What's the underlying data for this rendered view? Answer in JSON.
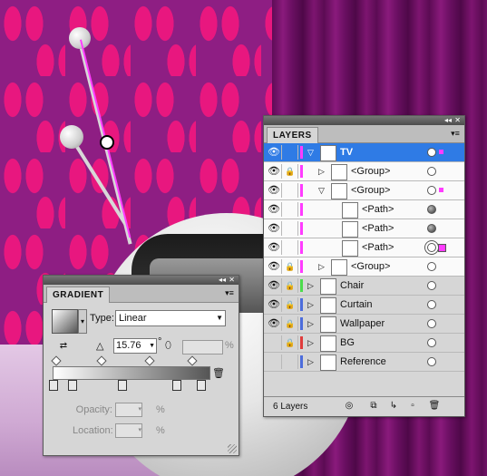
{
  "layers_panel": {
    "tab_label": "LAYERS",
    "footer": {
      "count_label": "6 Layers"
    },
    "rows": [
      {
        "name": "TV",
        "level": 0,
        "expanded": true,
        "selected": true,
        "color": "#ff3cff",
        "eye": true,
        "lock": false,
        "target": "open",
        "marker": "small"
      },
      {
        "name": "<Group>",
        "level": 1,
        "expanded": false,
        "selected": false,
        "color": "#ff3cff",
        "eye": true,
        "lock": true,
        "target": "open",
        "marker": "none"
      },
      {
        "name": "<Group>",
        "level": 1,
        "expanded": true,
        "selected": false,
        "color": "#ff3cff",
        "eye": true,
        "lock": false,
        "target": "open",
        "marker": "small"
      },
      {
        "name": "<Path>",
        "level": 2,
        "selected": false,
        "color": "#ff3cff",
        "eye": true,
        "lock": false,
        "target": "filled",
        "marker": "none"
      },
      {
        "name": "<Path>",
        "level": 2,
        "selected": false,
        "color": "#ff3cff",
        "eye": true,
        "lock": false,
        "target": "filled",
        "marker": "none"
      },
      {
        "name": "<Path>",
        "level": 2,
        "selected": false,
        "color": "#ff3cff",
        "eye": true,
        "lock": false,
        "target": "double",
        "marker": "big"
      },
      {
        "name": "<Group>",
        "level": 1,
        "expanded": false,
        "selected": false,
        "color": "#ff3cff",
        "eye": true,
        "lock": true,
        "target": "open",
        "marker": "none"
      },
      {
        "name": "Chair",
        "level": 0,
        "expanded": false,
        "selected": false,
        "color": "#4ddc4d",
        "eye": true,
        "lock": true,
        "target": "open",
        "marker": "none"
      },
      {
        "name": "Curtain",
        "level": 0,
        "expanded": false,
        "selected": false,
        "color": "#4d6ddc",
        "eye": true,
        "lock": true,
        "target": "open",
        "marker": "none"
      },
      {
        "name": "Wallpaper",
        "level": 0,
        "expanded": false,
        "selected": false,
        "color": "#4d6ddc",
        "eye": true,
        "lock": true,
        "target": "open",
        "marker": "none"
      },
      {
        "name": "BG",
        "level": 0,
        "expanded": false,
        "selected": false,
        "color": "#e03c3c",
        "eye": false,
        "lock": true,
        "target": "open",
        "marker": "none"
      },
      {
        "name": "Reference",
        "level": 0,
        "expanded": false,
        "selected": false,
        "color": "#4d6ddc",
        "eye": false,
        "lock": false,
        "target": "open",
        "marker": "none"
      }
    ]
  },
  "gradient_panel": {
    "tab_label": "GRADIENT",
    "type_label": "Type:",
    "type_value": "Linear",
    "angle_value": "15.76",
    "degree_symbol": "°",
    "aspect_unit": "%",
    "opacity_label": "Opacity:",
    "opacity_unit": "%",
    "location_label": "Location:",
    "location_unit": "%",
    "field_dots": "▾",
    "stop_positions_pct": [
      0,
      12,
      44,
      79,
      95
    ],
    "midpoint_positions_pct": [
      0,
      29,
      60,
      87
    ]
  },
  "colors": {
    "selection_blue": "#2f7be5",
    "selection_magenta": "#ff3cff",
    "wallpaper": "#8e1e83",
    "wallpaper_leaf": "#e8177f"
  }
}
